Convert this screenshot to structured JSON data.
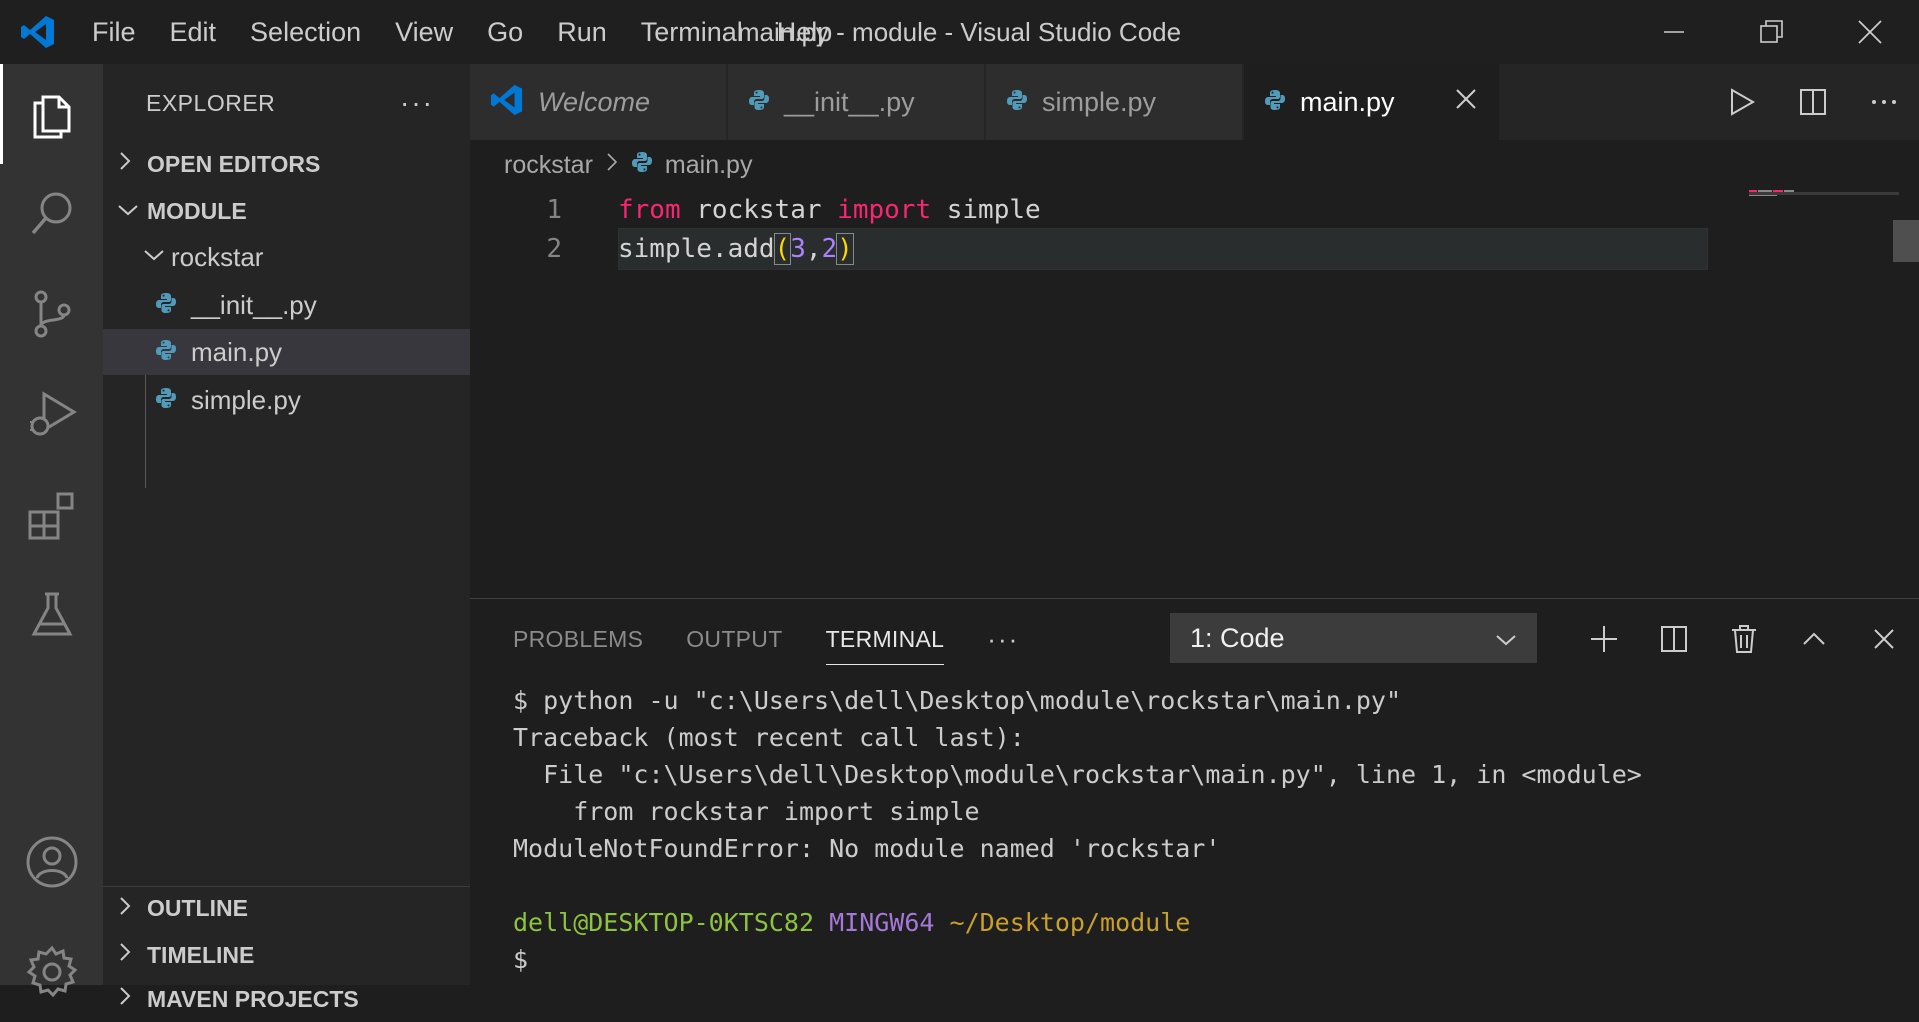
{
  "titlebar": {
    "menu": [
      "File",
      "Edit",
      "Selection",
      "View",
      "Go",
      "Run",
      "Terminal",
      "Help"
    ],
    "window_title": "main.py - module - Visual Studio Code"
  },
  "activity_bar": {
    "items": [
      "explorer-icon",
      "search-icon",
      "source-control-icon",
      "run-debug-icon",
      "extensions-icon",
      "testing-icon"
    ],
    "bottom_items": [
      "account-icon",
      "settings-gear-icon"
    ]
  },
  "sidebar": {
    "title": "EXPLORER",
    "more": "···",
    "sections": {
      "open_editors": "OPEN EDITORS",
      "module": "MODULE",
      "outline": "OUTLINE",
      "timeline": "TIMELINE",
      "maven": "MAVEN PROJECTS"
    },
    "tree": {
      "folder": "rockstar",
      "files": [
        "__init__.py",
        "main.py",
        "simple.py"
      ]
    }
  },
  "tabs": [
    {
      "label": "Welcome",
      "icon": "vscode-icon"
    },
    {
      "label": "__init__.py",
      "icon": "python-icon"
    },
    {
      "label": "simple.py",
      "icon": "python-icon"
    },
    {
      "label": "main.py",
      "icon": "python-icon",
      "active": true
    }
  ],
  "breadcrumb": {
    "folder": "rockstar",
    "file": "main.py"
  },
  "editor": {
    "lines": [
      {
        "number": "1",
        "tokens": [
          {
            "text": "from",
            "kind": "kw"
          },
          {
            "text": " rockstar ",
            "kind": "plain"
          },
          {
            "text": "import",
            "kind": "kw"
          },
          {
            "text": " simple",
            "kind": "plain"
          }
        ]
      },
      {
        "number": "2",
        "tokens": [
          {
            "text": "simple.add",
            "kind": "plain"
          },
          {
            "text": "(",
            "kind": "paren"
          },
          {
            "text": "3",
            "kind": "num"
          },
          {
            "text": ",",
            "kind": "plain"
          },
          {
            "text": "2",
            "kind": "num"
          },
          {
            "text": ")",
            "kind": "paren"
          }
        ]
      }
    ]
  },
  "panel": {
    "tabs": [
      "PROBLEMS",
      "OUTPUT",
      "TERMINAL"
    ],
    "active_tab": "TERMINAL",
    "more": "···",
    "terminal_select": "1: Code",
    "terminal_lines": [
      "$ python -u \"c:\\Users\\dell\\Desktop\\module\\rockstar\\main.py\"",
      "Traceback (most recent call last):",
      "  File \"c:\\Users\\dell\\Desktop\\module\\rockstar\\main.py\", line 1, in <module>",
      "    from rockstar import simple",
      "ModuleNotFoundError: No module named 'rockstar'",
      ""
    ],
    "prompt": {
      "user": "dell@DESKTOP-0KTSC82",
      "host": "MINGW64",
      "path": "~/Desktop/module",
      "symbol": "$"
    }
  },
  "colors": {
    "accent_vscode": "#0078d4",
    "python_icon": "#519aba",
    "keyword": "#f92672",
    "number": "#ae81ff"
  }
}
